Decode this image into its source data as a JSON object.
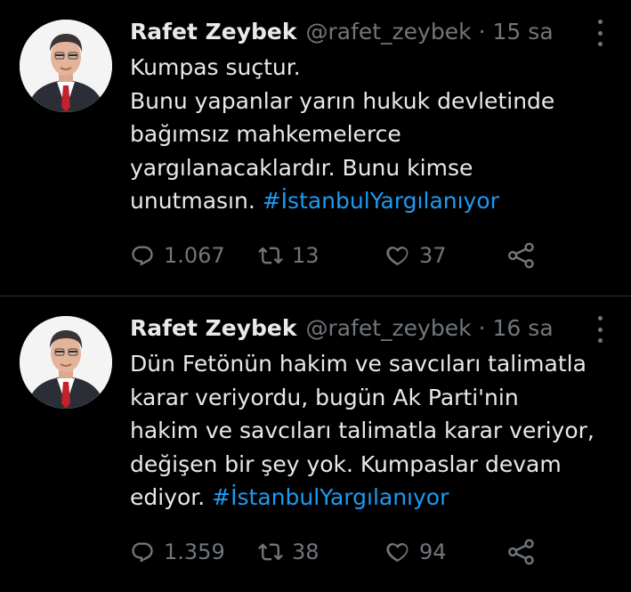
{
  "colors": {
    "background": "#000000",
    "text": "#e7e9ea",
    "muted": "#71767b",
    "link": "#1d9bf0",
    "divider": "#2f3336"
  },
  "icons": {
    "more": "more-dots-icon",
    "reply": "reply-icon",
    "retweet": "retweet-icon",
    "like": "heart-icon",
    "share": "share-icon"
  },
  "tweets": [
    {
      "author": {
        "name": "Rafet Zeybek",
        "handle": "@rafet_zeybek"
      },
      "separator": "·",
      "time": "15 sa",
      "lines": [
        "Kumpas suçtur.",
        "Bunu yapanlar yarın hukuk devletinde",
        "bağımsız mahkemelerce",
        "yargılanacaklardır. Bunu kimse"
      ],
      "last_line_text": "unutmasın. ",
      "hashtag": "#İstanbulYargılanıyor",
      "stats": {
        "replies": "1.067",
        "retweets": "13",
        "likes": "37"
      }
    },
    {
      "author": {
        "name": "Rafet Zeybek",
        "handle": "@rafet_zeybek"
      },
      "separator": "·",
      "time": "16 sa",
      "lines": [
        "Dün Fetönün hakim ve savcıları talimatla",
        "karar veriyordu, bugün Ak Parti'nin",
        "hakim ve savcıları talimatla karar veriyor,",
        "değişen bir şey yok. Kumpaslar devam"
      ],
      "last_line_text": "ediyor. ",
      "hashtag": "#İstanbulYargılanıyor",
      "stats": {
        "replies": "1.359",
        "retweets": "38",
        "likes": "94"
      }
    }
  ]
}
